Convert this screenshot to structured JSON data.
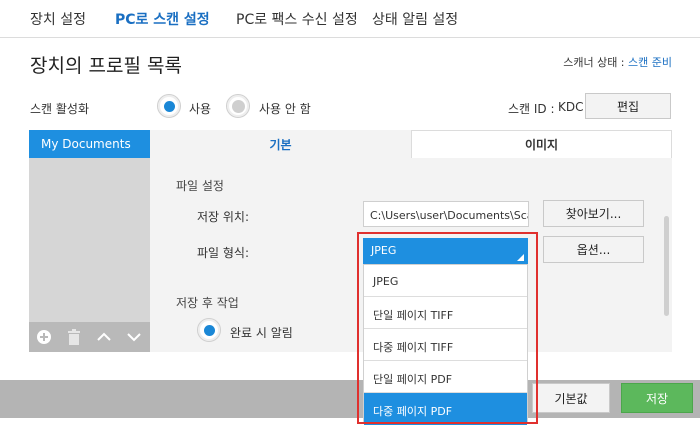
{
  "top_tabs": [
    {
      "label": "장치 설정"
    },
    {
      "label": "PC로 스캔 설정"
    },
    {
      "label": "PC로 팩스 수신 설정"
    },
    {
      "label": "상태 알림 설정"
    }
  ],
  "page": {
    "title": "장치의 프로필 목록",
    "scanner_status_label": "스캐너 상태 : ",
    "scanner_status_value": "스캔 준비"
  },
  "scan_activation": {
    "label": "스캔 활성화",
    "options": [
      {
        "label": "사용",
        "selected": true
      },
      {
        "label": "사용 안 함",
        "selected": false
      }
    ],
    "scan_id_label": "스캔 ID :",
    "scan_id_value": "KDC",
    "edit_button": "편집"
  },
  "sidebar": {
    "items": [
      {
        "label": "My Documents"
      }
    ],
    "tool_icons": [
      "plus-circle-icon",
      "trash-icon",
      "chevron-up-icon",
      "chevron-down-icon"
    ]
  },
  "tabs": [
    {
      "label": "기본",
      "active": true
    },
    {
      "label": "이미지",
      "active": false
    }
  ],
  "file_settings": {
    "section_title": "파일 설정",
    "location_label": "저장 위치:",
    "location_value": "C:\\Users\\user\\Documents\\Scan",
    "browse_button": "찾아보기...",
    "format_label": "파일 형식:",
    "format_value": "JPEG",
    "options_button": "옵션...",
    "format_options": [
      "JPEG",
      "단일 페이지 TIFF",
      "다중 페이지 TIFF",
      "단일 페이지 PDF",
      "다중 페이지 PDF"
    ],
    "highlighted_option_index": 4
  },
  "after_save": {
    "section_title": "저장 후 작업",
    "notify_label": "완료 시 알림"
  },
  "footer": {
    "default_button": "기본값",
    "save_button": "저장"
  },
  "colors": {
    "accent": "#1e8fe0",
    "save_green": "#5cb85c",
    "highlight_red": "#e0302e"
  }
}
